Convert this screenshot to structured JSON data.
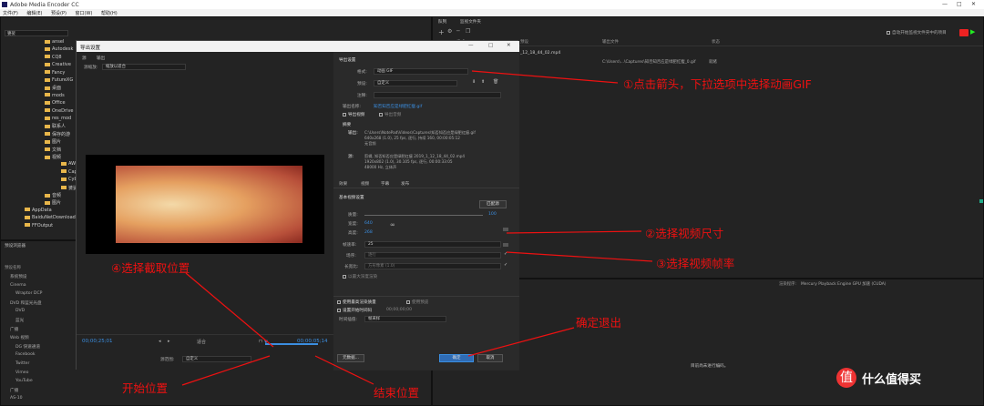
{
  "window": {
    "title": "Adobe Media Encoder CC",
    "controls": [
      "—",
      "□",
      "✕"
    ]
  },
  "menu": [
    "文件(F)",
    "编辑(E)",
    "预设(P)",
    "窗口(W)",
    "帮助(H)"
  ],
  "media_browser": {
    "location": "婆娑",
    "items": [
      "ansel",
      "Autodesk",
      "CQ8",
      "Creative",
      "Fancy",
      "FutureXG",
      "桌面",
      "mods",
      "Office",
      "OneDrive",
      "res_mod",
      "联系人",
      "保存的游",
      "图片",
      "文档",
      "视频",
      "AWL",
      "Captures",
      "Cyberlink",
      "婆娑",
      "音频",
      "图片",
      "AppData",
      "BaiduNetDownload",
      "FFOutput"
    ]
  },
  "preset_browser": {
    "title": "预设浏览器",
    "column": "预设名称",
    "items": [
      "系统预设",
      "Cinema",
      "Wraptor DCP",
      "DVD 和蓝光光盘",
      "DVD",
      "蓝光",
      "广播",
      "Web 视频",
      "DG 快速通道",
      "Facebook",
      "Twitter",
      "Vimeo",
      "YouTube",
      "广播",
      "AS-10"
    ]
  },
  "queue": {
    "tab": "队列",
    "tab2": "监视文件夹",
    "columns": [
      "格式",
      "预设",
      "输出文件",
      "状态"
    ],
    "file": "_12_18_44_02.mp4",
    "output": "C:\\Users\\...\\Captures\\知否知否应是绿肥红瘦_0.gif",
    "status": "就绪",
    "auto_start": "自动开始监视文件夹中的项目",
    "renderer_label": "渲染程序:",
    "renderer": "Mercury Playback Engine GPU 加速 (CUDA)",
    "encoding_label": "编码",
    "idle": "目前尚未进行编码。"
  },
  "dialog": {
    "title": "导出设置",
    "tab_source": "源",
    "tab_output": "输出",
    "scaling_label": "源缩放:",
    "scaling_value": "缩放以适合",
    "export_settings_header": "导出设置",
    "format_label": "格式:",
    "format_value": "动画 GIF",
    "preset_label": "预设:",
    "preset_value": "自定义",
    "comment_label": "注释:",
    "output_name_label": "输出名称:",
    "output_name": "知否知否应是绿肥红瘦.gif",
    "export_video": "导出视频",
    "export_audio": "导出音频",
    "summary_header": "摘要",
    "output_label": "输出:",
    "output_lines": [
      "C:\\Users\\NotePad\\Videos\\Captures\\知否知否应是绿肥红瘦.gif",
      "640x268 (1.0), 25 fps, 逐行, 持续 160, 00:00:05:12",
      "无音频"
    ],
    "source_label": "源:",
    "source_lines": [
      "剪辑, 知否知否应是绿肥红瘦 2019_1_12_18_44_02.mp4",
      "1920x802 (1.0), 30.105 fps, 逐行, 00:00:33:05",
      "48000 Hz, 立体声"
    ],
    "tabs": [
      "效果",
      "视频",
      "字幕",
      "发布"
    ],
    "basic_video_header": "基本视频设置",
    "match_source": "匹配源",
    "quality_label": "质量:",
    "quality_value": "100",
    "width_label": "宽度:",
    "width_value": "640",
    "height_label": "高度:",
    "height_value": "268",
    "framerate_label": "帧速率:",
    "framerate_value": "25",
    "field_order_label": "场序:",
    "field_order_value": "逐行",
    "aspect_label": "长宽比:",
    "aspect_value": "方形像素 (1.0)",
    "render_max_depth": "以最大深度渲染",
    "use_max_quality": "使用最高渲染质量",
    "use_preview": "使用预览",
    "set_start_timecode": "设置开始时间码",
    "start_timecode": "00;00;00;00",
    "interpolation_label": "时间插值:",
    "interpolation_value": "帧采样",
    "metadata_button": "元数据...",
    "ok_button": "确定",
    "cancel_button": "取消",
    "timecode_current": "00;00;25;01",
    "fit_label": "适合",
    "timecode_duration": "00;00;05;14",
    "source_range_label": "源范围:",
    "source_range_value": "自定义"
  },
  "annotations": {
    "a1": "①点击箭头，下拉选项中选择动画GIF",
    "a2": "②选择视频尺寸",
    "a3": "③选择视频帧率",
    "a4": "④选择截取位置",
    "confirm": "确定退出",
    "start": "开始位置",
    "end": "结束位置"
  },
  "colors": {
    "annotation": "#e11",
    "accent": "#3b8ee0",
    "dialog_bg": "#2b2b2b"
  }
}
